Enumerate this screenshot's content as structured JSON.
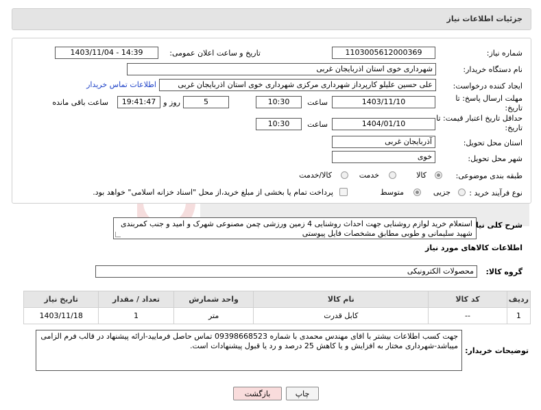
{
  "header": {
    "title": "جزئیات اطلاعات نیاز"
  },
  "form": {
    "need_number_label": "شماره نیاز:",
    "need_number": "1103005612000369",
    "announce_label": "تاریخ و ساعت اعلان عمومی:",
    "announce_value": "1403/11/04 - 14:39",
    "buyer_org_label": "نام دستگاه خریدار:",
    "buyer_org": "شهرداری خوی استان اذربایجان غربی",
    "creator_label": "ایجاد کننده درخواست:",
    "creator": "علی حسین علیلو کارپرداز شهرداری مرکزی شهرداری خوی استان اذربایجان غربی",
    "contact_link": "اطلاعات تماس خریدار",
    "deadline_label": "مهلت ارسال پاسخ: تا تاریخ:",
    "deadline_date": "1403/11/10",
    "time_label": "ساعت",
    "deadline_time": "10:30",
    "days_value": "5",
    "days_label": "روز و",
    "remaining_time": "19:41:47",
    "remaining_label": "ساعت باقی مانده",
    "validity_label": "حداقل تاریخ اعتبار قیمت: تا تاریخ:",
    "validity_date": "1404/01/10",
    "validity_time": "10:30",
    "province_label": "استان محل تحویل:",
    "province": "آذربایجان غربی",
    "city_label": "شهر محل تحویل:",
    "city": "خوی",
    "category_label": "طبقه بندی موضوعی:",
    "category_options": [
      "کالا",
      "خدمت",
      "کالا/خدمت"
    ],
    "purchase_type_label": "نوع فرآیند خرید :",
    "purchase_type_options": [
      "جزیی",
      "متوسط"
    ],
    "payment_note": "پرداخت تمام یا بخشی از مبلغ خرید،از محل \"اسناد خزانه اسلامی\" خواهد بود."
  },
  "description": {
    "label": "شرح کلی نیاز:",
    "text": "استعلام خرید لوازم روشنایی جهت احداث روشنایی 4 زمین ورزشی چمن مصنوعی شهرک و امید و جنب کمربندی شهید سلیمانی و طوبی مطابق مشخصات فایل پیوستی"
  },
  "goods": {
    "section_title": "اطلاعات کالاهای مورد نیاز",
    "group_label": "گروه کالا:",
    "group_value": "محصولات الکترونیکی",
    "columns": [
      "ردیف",
      "کد کالا",
      "نام کالا",
      "واحد شمارش",
      "تعداد / مقدار",
      "تاریخ نیاز"
    ],
    "rows": [
      {
        "row": "1",
        "code": "--",
        "name": "کابل قدرت",
        "unit": "متر",
        "qty": "1",
        "date": "1403/11/18"
      }
    ]
  },
  "buyer_notes": {
    "label": "توضیحات خریدار:",
    "text": "جهت کسب اطلاعات بیشتر با اقای مهندس محمدی با شماره 09398668523 تماس حاصل فرمایید-ارائه پیشنهاد در قالب فرم الزامی میباشد-شهرداری مختار به افزایش و یا کاهش 25 درصد و رد یا قبول پیشنهادات است."
  },
  "buttons": {
    "print": "چاپ",
    "back": "بازگشت"
  },
  "colors": {
    "link": "#1a3fc7",
    "header_bg": "#e4e4e4",
    "back_button_bg": "#f9dcdc"
  }
}
